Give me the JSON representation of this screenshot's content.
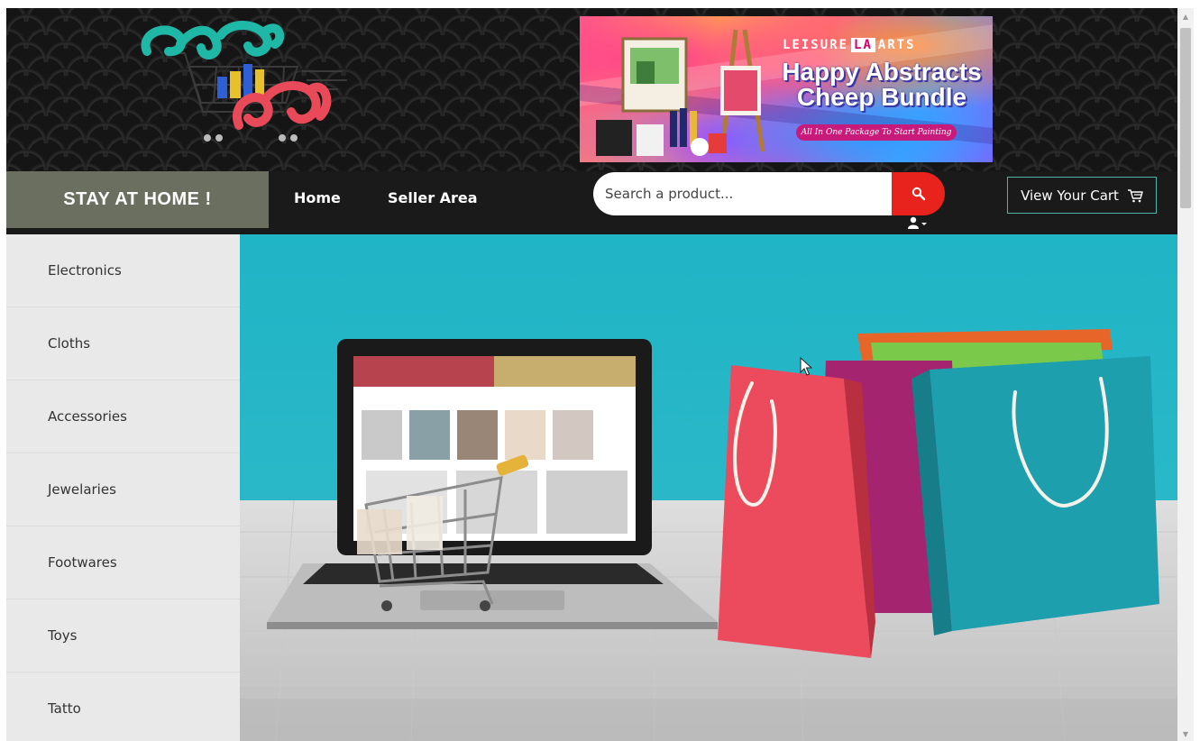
{
  "logo": {
    "icon": "shopping-cart-logo"
  },
  "banner": {
    "brand_left": "LEISURE",
    "brand_mark": "LA",
    "brand_right": "ARTS",
    "title_line1": "Happy Abstracts",
    "title_line2": "Cheep Bundle",
    "tagline": "All In One Package To Start Painting"
  },
  "nav": {
    "promo_label": "STAY AT HOME !",
    "links": [
      {
        "label": "Home"
      },
      {
        "label": "Seller Area"
      }
    ],
    "search": {
      "placeholder": "Search a product...",
      "value": "",
      "icon": "search-icon"
    },
    "user_icon": "user-icon",
    "cart": {
      "label": "View Your Cart",
      "icon": "cart-icon"
    }
  },
  "sidebar": {
    "categories": [
      {
        "label": "Electronics"
      },
      {
        "label": "Cloths"
      },
      {
        "label": "Accessories"
      },
      {
        "label": "Jewelaries"
      },
      {
        "label": "Footwares"
      },
      {
        "label": "Toys"
      },
      {
        "label": "Tatto"
      }
    ]
  },
  "colors": {
    "header_bg": "#151515",
    "navbar_bg": "#1a1a1a",
    "promo_bg": "#6b6f5f",
    "search_button": "#e8221c",
    "cart_border": "#4fb3a8",
    "sidebar_bg": "#e9e9e9",
    "hero_bg": "#23b5c7"
  }
}
